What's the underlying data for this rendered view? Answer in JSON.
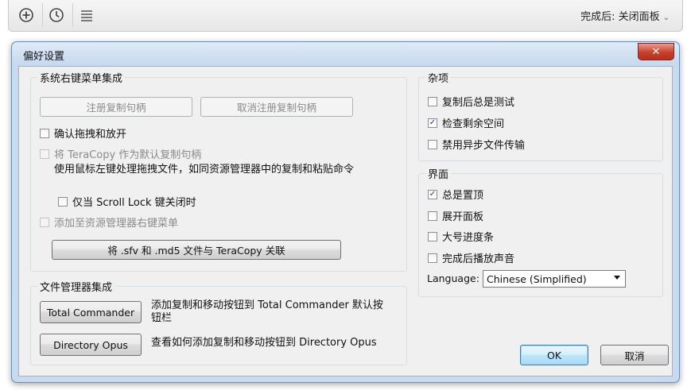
{
  "toolbar": {
    "buttons": [
      "add-icon",
      "clock-icon",
      "menu-icon"
    ],
    "after_complete_label": "完成后: 关闭面板",
    "after_complete_chevron": "⌄"
  },
  "dialog": {
    "title": "偏好设置",
    "close_glyph": "✕"
  },
  "shell_integration": {
    "title": "系统右键菜单集成",
    "register_button": "注册复制句柄",
    "unregister_button": "取消注册复制句柄",
    "confirm_drag_drop": {
      "label": "确认拖拽和放开",
      "checked": false,
      "disabled": false
    },
    "default_copy_handler": {
      "label": "将 TeraCopy 作为默认复制句柄",
      "checked": false,
      "disabled": true
    },
    "default_copy_handler_desc": "使用鼠标左键处理拖拽文件，如同资源管理器中的复制和粘贴命令",
    "scroll_lock_only": {
      "label": "仅当 Scroll Lock 键关闭时",
      "checked": false,
      "disabled": false
    },
    "add_to_context_menu": {
      "label": "添加至资源管理器右键菜单",
      "checked": false,
      "disabled": true
    },
    "associate_button": "将 .sfv 和 .md5 文件与 TeraCopy 关联"
  },
  "file_manager_integration": {
    "title": "文件管理器集成",
    "total_commander_button": "Total Commander",
    "total_commander_desc_1": "添加复制和移动按钮到 Total Commander 默认按",
    "total_commander_desc_2": "钮栏",
    "directory_opus_button": "Directory Opus",
    "directory_opus_desc": "查看如何添加复制和移动按钮到 Directory Opus"
  },
  "misc": {
    "title": "杂项",
    "items": [
      {
        "label": "复制后总是测试",
        "checked": false
      },
      {
        "label": "检查剩余空间",
        "checked": true
      },
      {
        "label": "禁用异步文件传输",
        "checked": false
      }
    ]
  },
  "interface": {
    "title": "界面",
    "items": [
      {
        "label": "总是置顶",
        "checked": true
      },
      {
        "label": "展开面板",
        "checked": false
      },
      {
        "label": "大号进度条",
        "checked": false
      },
      {
        "label": "完成后播放声音",
        "checked": false
      }
    ],
    "language_label": "Language:",
    "language_value": "Chinese (Simplified)"
  },
  "footer": {
    "ok_button": "OK",
    "cancel_button": "取消"
  },
  "check_glyph": "✓"
}
